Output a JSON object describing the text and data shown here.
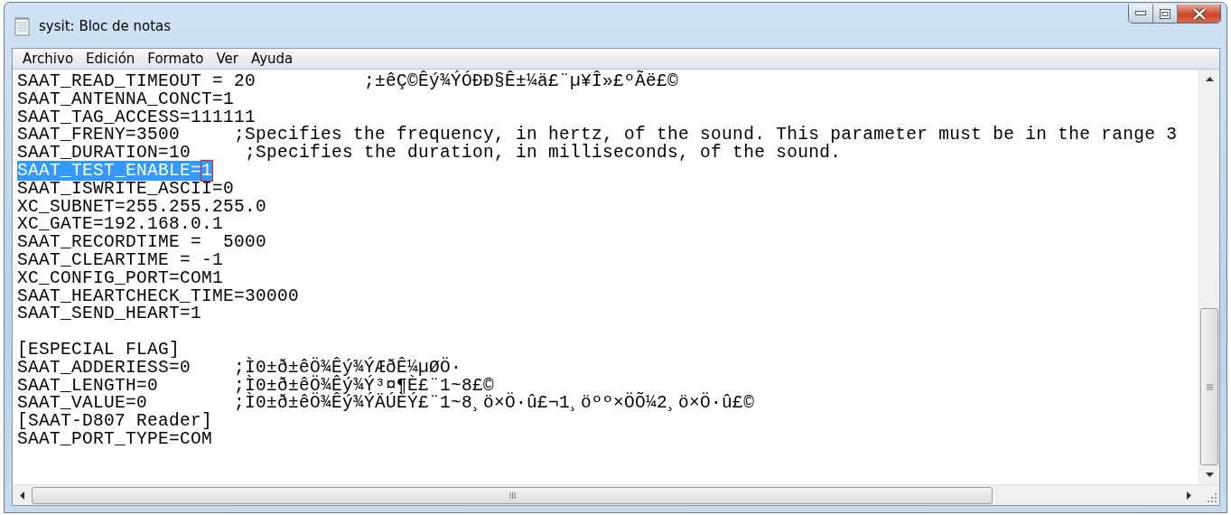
{
  "window": {
    "title": "sysit: Bloc de notas"
  },
  "menu": [
    "Archivo",
    "Edición",
    "Formato",
    "Ver",
    "Ayuda"
  ],
  "lines": [
    {
      "kind": "text",
      "text": "SAAT_READ_TIMEOUT = 20          ;±êÇ©Êý¾ÝÓÐÐ§Ê±¼ä£¨µ¥Î»£ºÃë£©",
      "selected": false
    },
    {
      "kind": "text",
      "text": "SAAT_ANTENNA_CONCT=1",
      "selected": false
    },
    {
      "kind": "text",
      "text": "SAAT_TAG_ACCESS=111111",
      "selected": false
    },
    {
      "kind": "text",
      "text": "SAAT_FRENY=3500     ;Specifies the frequency, in hertz, of the sound. This parameter must be in the range 3",
      "selected": false
    },
    {
      "kind": "text",
      "text": "SAAT_DURATION=10     ;Specifies the duration, in milliseconds, of the sound.",
      "selected": false
    },
    {
      "kind": "text",
      "text": "SAAT_TEST_ENABLE=",
      "boxed": "1",
      "selected": true
    },
    {
      "kind": "text",
      "text": "SAAT_ISWRITE_ASCII=0",
      "selected": false
    },
    {
      "kind": "text",
      "text": "XC_SUBNET=255.255.255.0",
      "selected": false
    },
    {
      "kind": "text",
      "text": "XC_GATE=192.168.0.1",
      "selected": false
    },
    {
      "kind": "text",
      "text": "SAAT_RECORDTIME =  5000",
      "selected": false
    },
    {
      "kind": "text",
      "text": "SAAT_CLEARTIME = -1",
      "selected": false
    },
    {
      "kind": "text",
      "text": "XC_CONFIG_PORT=COM1",
      "selected": false
    },
    {
      "kind": "text",
      "text": "SAAT_HEARTCHECK_TIME=30000",
      "selected": false
    },
    {
      "kind": "text",
      "text": "SAAT_SEND_HEART=1",
      "selected": false
    },
    {
      "kind": "blank"
    },
    {
      "kind": "text",
      "text": "[ESPECIAL FLAG]",
      "selected": false
    },
    {
      "kind": "text",
      "text": "SAAT_ADDERIESS=0    ;Ì0±ð±êÖ¾Êý¾ÝÆðÊ¼µØÖ·",
      "selected": false
    },
    {
      "kind": "text",
      "text": "SAAT_LENGTH=0       ;Ì0±ð±êÖ¾Êý¾Ý³¤¶È£¨1~8£©",
      "selected": false
    },
    {
      "kind": "text",
      "text": "SAAT_VALUE=0        ;Ì0±ð±êÖ¾Êý¾ÝÄÚÈÝ£¨1~8¸ö×Ö·û£¬1¸öºº×ÖÕ¼2¸ö×Ö·û£©",
      "selected": false
    },
    {
      "kind": "text",
      "text": "[SAAT-D807 Reader]",
      "selected": false
    },
    {
      "kind": "text",
      "text": "SAAT_PORT_TYPE=COM",
      "selected": false
    }
  ]
}
